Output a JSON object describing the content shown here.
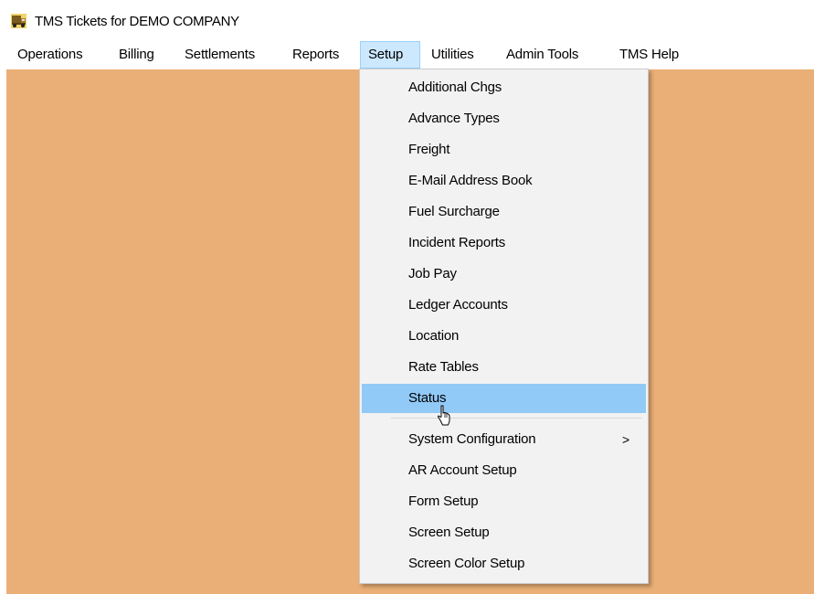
{
  "window": {
    "title": "TMS Tickets for DEMO COMPANY",
    "icon": "truck-app-icon"
  },
  "menu_bar": {
    "items": [
      {
        "label": "Operations",
        "active": false
      },
      {
        "label": "Billing",
        "active": false
      },
      {
        "label": "Settlements",
        "active": false
      },
      {
        "label": "Reports",
        "active": false
      },
      {
        "label": "Setup",
        "active": true
      },
      {
        "label": "Utilities",
        "active": false
      },
      {
        "label": "Admin Tools",
        "active": false
      },
      {
        "label": "TMS Help",
        "active": false
      }
    ]
  },
  "setup_menu": {
    "items": [
      {
        "label": "Additional Chgs"
      },
      {
        "label": "Advance Types"
      },
      {
        "label": "Freight"
      },
      {
        "label": "E-Mail Address Book"
      },
      {
        "label": "Fuel Surcharge"
      },
      {
        "label": "Incident Reports"
      },
      {
        "label": "Job Pay"
      },
      {
        "label": "Ledger Accounts"
      },
      {
        "label": "Location"
      },
      {
        "label": "Rate Tables"
      },
      {
        "label": "Status",
        "highlighted": true
      },
      {
        "label": "System Configuration",
        "submenu_arrow": ">"
      },
      {
        "label": "AR Account Setup"
      },
      {
        "label": "Form Setup"
      },
      {
        "label": "Screen Setup"
      },
      {
        "label": "Screen Color Setup"
      }
    ]
  },
  "colors": {
    "workspace_background": "#eaaf76",
    "menu_background": "#f2f2f2",
    "highlight": "#91c9f7",
    "active_menu_background": "#cce8ff"
  },
  "cursor": "mouse-pointer-icon"
}
